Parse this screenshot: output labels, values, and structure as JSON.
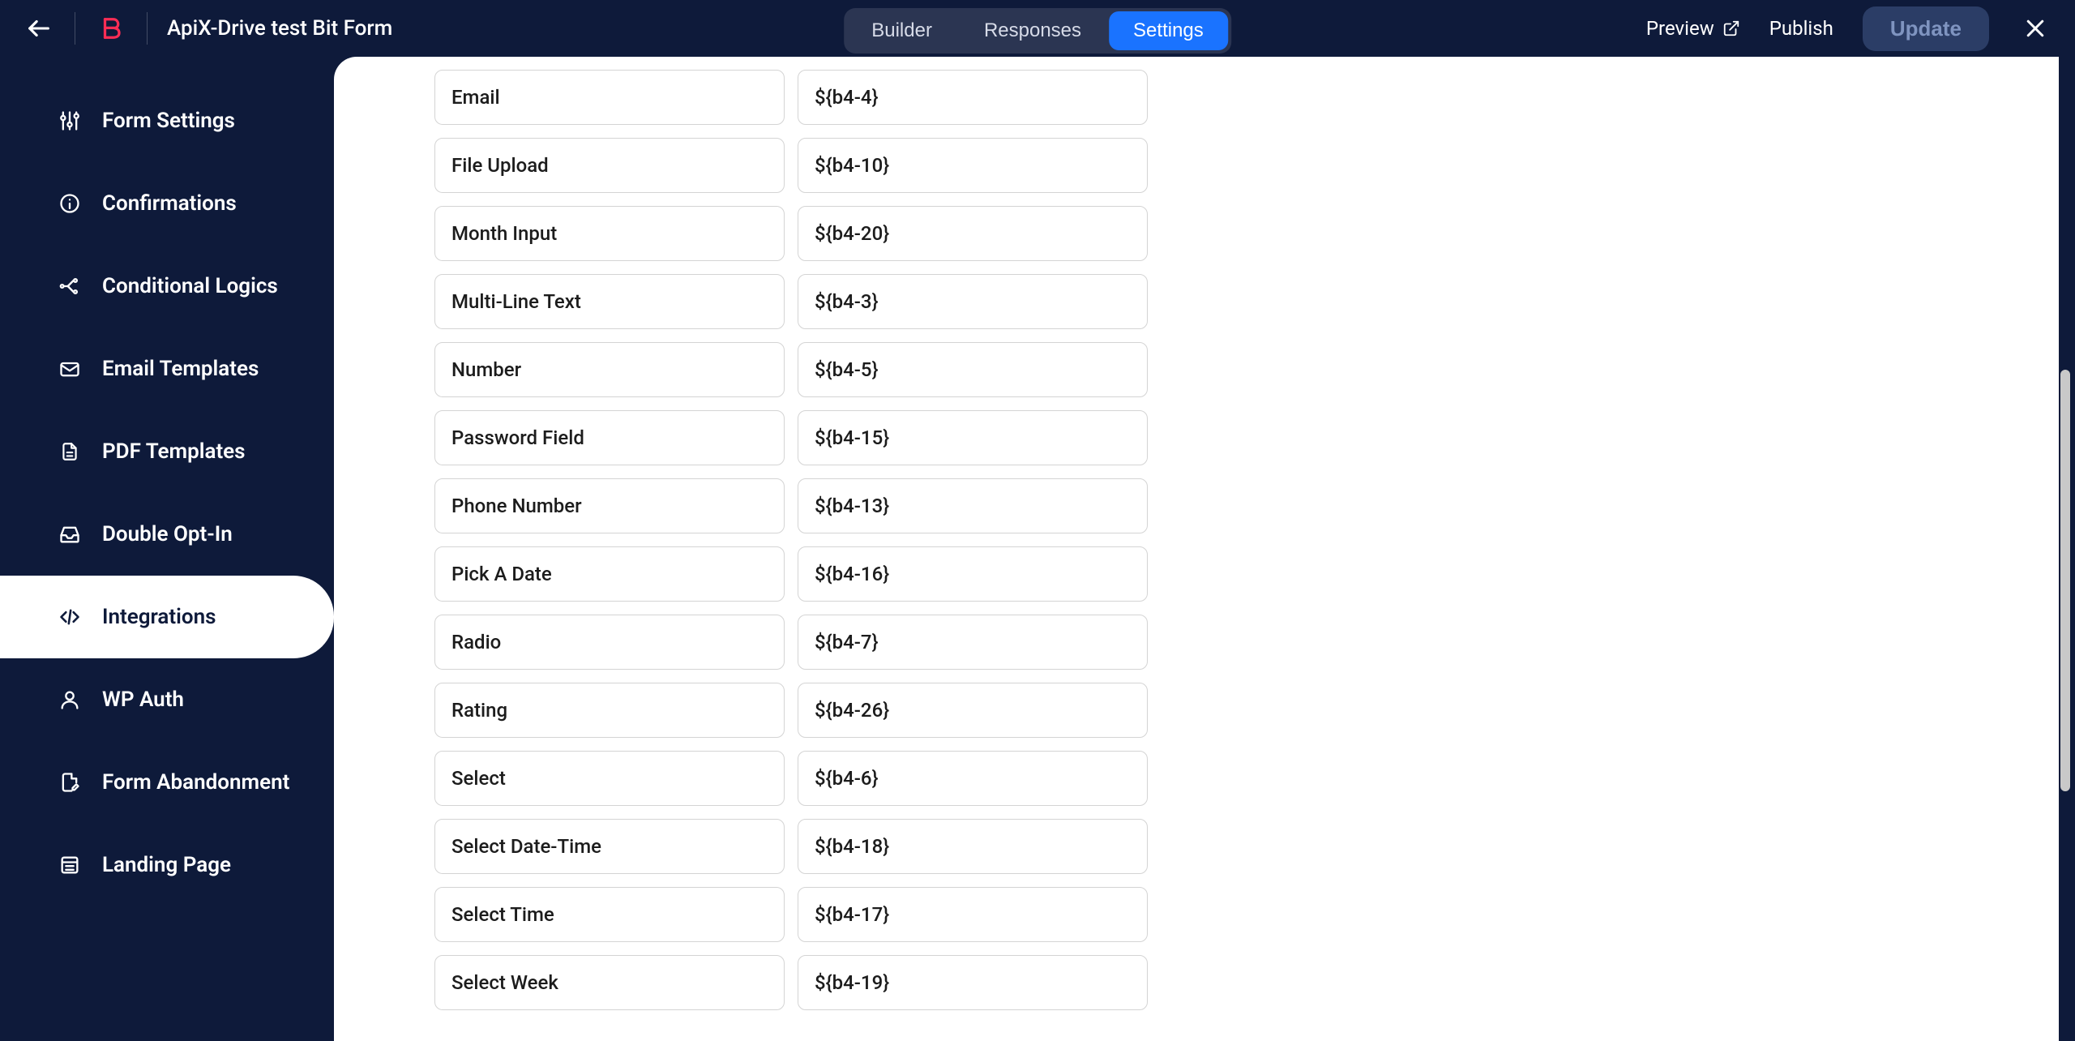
{
  "header": {
    "form_title": "ApiX-Drive test Bit Form",
    "tabs": {
      "builder": "Builder",
      "responses": "Responses",
      "settings": "Settings"
    },
    "preview": "Preview",
    "publish": "Publish",
    "update": "Update"
  },
  "sidebar": {
    "items": [
      {
        "id": "form-settings",
        "label": "Form Settings"
      },
      {
        "id": "confirmations",
        "label": "Confirmations"
      },
      {
        "id": "conditional-logics",
        "label": "Conditional Logics"
      },
      {
        "id": "email-templates",
        "label": "Email Templates"
      },
      {
        "id": "pdf-templates",
        "label": "PDF Templates"
      },
      {
        "id": "double-opt-in",
        "label": "Double Opt-In"
      },
      {
        "id": "integrations",
        "label": "Integrations"
      },
      {
        "id": "wp-auth",
        "label": "WP Auth"
      },
      {
        "id": "form-abandonment",
        "label": "Form Abandonment"
      },
      {
        "id": "landing-page",
        "label": "Landing Page"
      }
    ],
    "active_index": 6
  },
  "fields": [
    {
      "label": "Email",
      "code": "${b4-4}"
    },
    {
      "label": "File Upload",
      "code": "${b4-10}"
    },
    {
      "label": "Month Input",
      "code": "${b4-20}"
    },
    {
      "label": "Multi-Line Text",
      "code": "${b4-3}"
    },
    {
      "label": "Number",
      "code": "${b4-5}"
    },
    {
      "label": "Password Field",
      "code": "${b4-15}"
    },
    {
      "label": "Phone Number",
      "code": "${b4-13}"
    },
    {
      "label": "Pick A Date",
      "code": "${b4-16}"
    },
    {
      "label": "Radio",
      "code": "${b4-7}"
    },
    {
      "label": "Rating",
      "code": "${b4-26}"
    },
    {
      "label": "Select",
      "code": "${b4-6}"
    },
    {
      "label": "Select Date-Time",
      "code": "${b4-18}"
    },
    {
      "label": "Select Time",
      "code": "${b4-17}"
    },
    {
      "label": "Select Week",
      "code": "${b4-19}"
    }
  ],
  "colors": {
    "page_bg": "#0e1a3a",
    "accent": "#1a73ff",
    "brand": "#ff2d55"
  }
}
